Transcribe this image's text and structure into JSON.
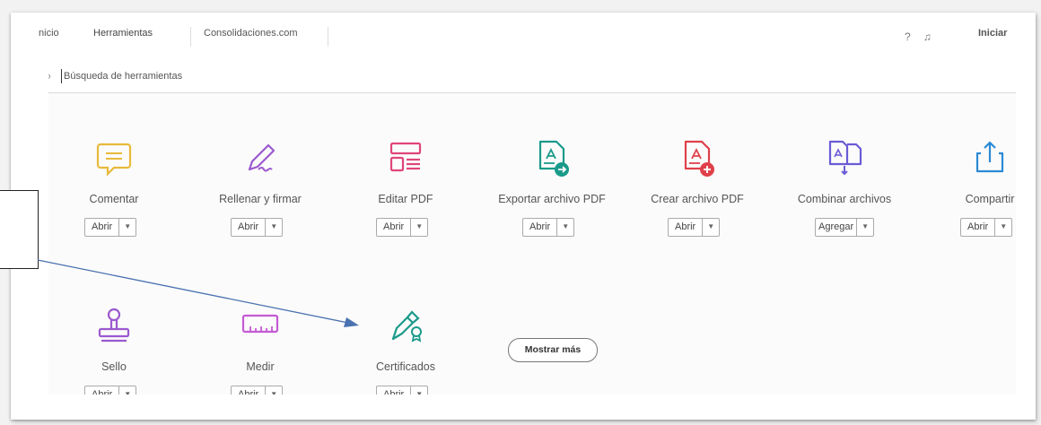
{
  "tabs": [
    "Inicio",
    "Herramientas",
    "Consolidaciones.com"
  ],
  "header_right": {
    "help_icon": "help-circle-icon",
    "bell_icon": "bell-icon",
    "signin_label": "Iniciar"
  },
  "search": {
    "placeholder": "Búsqueda de herramientas",
    "icon": "search-icon"
  },
  "tools_row1": [
    {
      "label": "Comentar",
      "button": "Abrir",
      "icon": "comment-icon",
      "color": "#e8b93a"
    },
    {
      "label": "Rellenar y firmar",
      "button": "Abrir",
      "icon": "fill-sign-icon",
      "color": "#9b59d0"
    },
    {
      "label": "Editar PDF",
      "button": "Abrir",
      "icon": "edit-pdf-icon",
      "color": "#e0457b"
    },
    {
      "label": "Exportar archivo PDF",
      "button": "Abrir",
      "icon": "export-pdf-icon",
      "color": "#1a9a8a"
    },
    {
      "label": "Crear archivo PDF",
      "button": "Abrir",
      "icon": "create-pdf-icon",
      "color": "#e0404a"
    },
    {
      "label": "Combinar archivos",
      "button": "Agregar",
      "icon": "combine-files-icon",
      "color": "#6a5bd6"
    },
    {
      "label": "Compartir",
      "button": "Abrir",
      "icon": "share-icon",
      "color": "#2a8ad6"
    }
  ],
  "tools_row2": [
    {
      "label": "Sello",
      "button": "Abrir",
      "icon": "stamp-icon",
      "color": "#9b59d0"
    },
    {
      "label": "Medir",
      "button": "Abrir",
      "icon": "measure-icon",
      "color": "#c45ad4"
    },
    {
      "label": "Certificados",
      "button": "Abrir",
      "icon": "certificates-icon",
      "color": "#1a9a8a"
    }
  ],
  "more_button": "Mostrar más",
  "annotation_color": "#4a72b0"
}
